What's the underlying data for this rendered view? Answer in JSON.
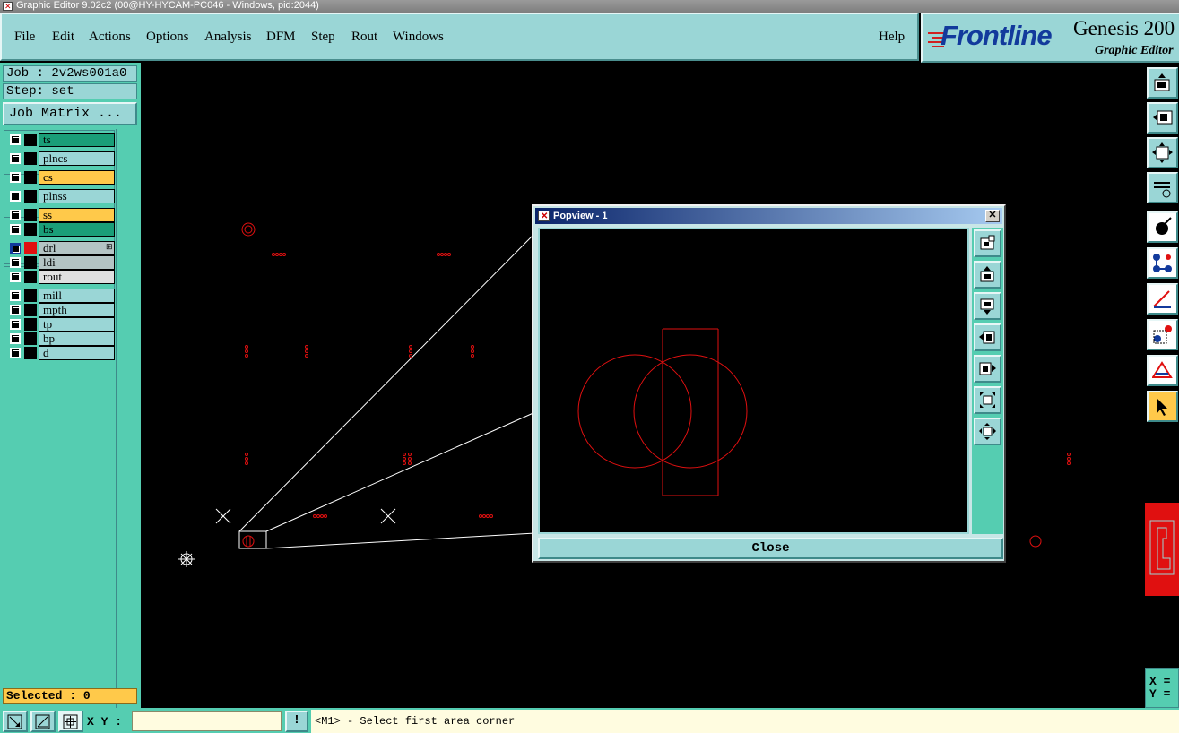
{
  "window": {
    "title": "Graphic Editor 9.02c2 (00@HY-HYCAM-PC046 - Windows, pid:2044)"
  },
  "menu": {
    "items": [
      "File",
      "Edit",
      "Actions",
      "Options",
      "Analysis",
      "DFM",
      "Step",
      "Rout",
      "Windows"
    ],
    "help": "Help"
  },
  "logo": {
    "brand": "Frontline",
    "product": "Genesis 200",
    "subtitle": "Graphic Editor"
  },
  "job": {
    "job_line": "Job : 2v2ws001a0",
    "step_line": "Step: set",
    "matrix_button": "Job Matrix ..."
  },
  "layers": [
    {
      "name": "ts",
      "color": "#1a9e78"
    },
    {
      "name": "plncs",
      "color": "#9ad6d6"
    },
    {
      "name": "cs",
      "color": "#ffc94a"
    },
    {
      "name": "plnss",
      "color": "#9ad6d6"
    },
    {
      "name": "ss",
      "color": "#ffc94a"
    },
    {
      "name": "bs",
      "color": "#1a9e78"
    },
    {
      "name": "drl",
      "color": "#b4c4c4",
      "work": true
    },
    {
      "name": "ldi",
      "color": "#b4c4c4"
    },
    {
      "name": "rout",
      "color": "#e0e0e0"
    },
    {
      "name": "mill",
      "color": "#9ad6d6"
    },
    {
      "name": "mpth",
      "color": "#9ad6d6"
    },
    {
      "name": "tp",
      "color": "#9ad6d6"
    },
    {
      "name": "bp",
      "color": "#9ad6d6"
    },
    {
      "name": "d",
      "color": "#9ad6d6"
    }
  ],
  "selected": "Selected : 0",
  "coords": {
    "x_label": "X =",
    "y_label": "Y ="
  },
  "statusbar": {
    "xy_label": "X Y :",
    "xy_value": "",
    "alert": "!",
    "message": "<M1> - Select first area corner"
  },
  "popview": {
    "title": "Popview - 1",
    "close_x": "✕",
    "close_button": "Close"
  },
  "colors": {
    "panel": "#55cdb1",
    "button": "#9ad6d6",
    "feature": "#e01010",
    "highlight": "#ffc94a"
  }
}
